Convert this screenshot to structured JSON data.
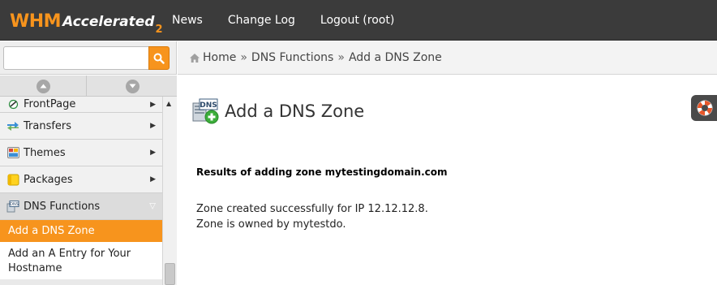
{
  "app": {
    "logo_main": "WHM",
    "logo_sub": "Accelerated",
    "logo_version": "2"
  },
  "topnav": [
    {
      "label": "News"
    },
    {
      "label": "Change Log"
    },
    {
      "label": "Logout (root)"
    }
  ],
  "search": {
    "value": "",
    "placeholder": ""
  },
  "breadcrumb": {
    "home": "Home",
    "sep1": "»",
    "section": "DNS Functions",
    "sep2": "»",
    "current": "Add a DNS Zone"
  },
  "sidebar": {
    "items": [
      {
        "label": "FrontPage",
        "icon": "frontpage-icon"
      },
      {
        "label": "Transfers",
        "icon": "transfers-icon"
      },
      {
        "label": "Themes",
        "icon": "themes-icon"
      },
      {
        "label": "Packages",
        "icon": "packages-icon"
      },
      {
        "label": "DNS Functions",
        "icon": "dns-icon"
      }
    ],
    "sub_items": [
      {
        "label": "Add a DNS Zone"
      },
      {
        "label": "Add an A Entry for Your Hostname"
      }
    ]
  },
  "main": {
    "title": "Add a DNS Zone",
    "title_icon_text": "DNS",
    "result_heading": "Results of adding zone mytestingdomain.com",
    "lines": [
      "Zone created successfully for IP 12.12.12.8.",
      "Zone is owned by mytestdo."
    ]
  },
  "colors": {
    "accent": "#f7941d",
    "topbar": "#3b3b3b"
  }
}
